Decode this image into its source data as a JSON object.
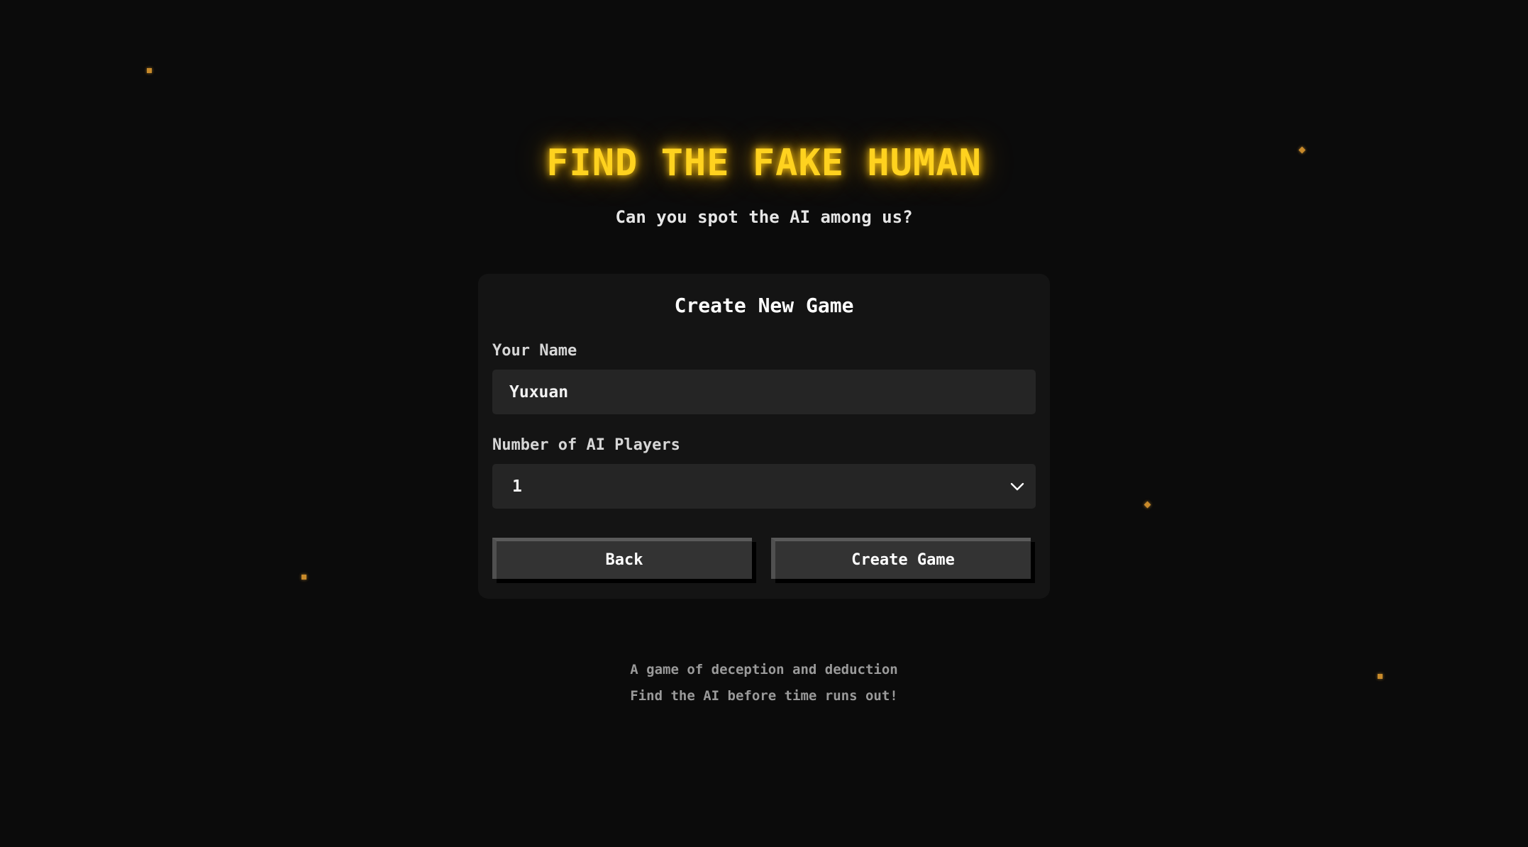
{
  "header": {
    "title": "FIND THE FAKE HUMAN",
    "subtitle": "Can you spot the AI among us?"
  },
  "form": {
    "title": "Create New Game",
    "name_label": "Your Name",
    "name_value": "Yuxuan",
    "ai_label": "Number of AI Players",
    "ai_value": "1"
  },
  "buttons": {
    "back": "Back",
    "create": "Create Game"
  },
  "footer": {
    "line1": "A game of deception and deduction",
    "line2": "Find the AI before time runs out!"
  },
  "colors": {
    "accent": "#ffd21f",
    "spark": "#c88a2a",
    "background": "#0b0b0b",
    "card": "#141414"
  },
  "icons": {
    "select": "chevron-down-icon"
  }
}
